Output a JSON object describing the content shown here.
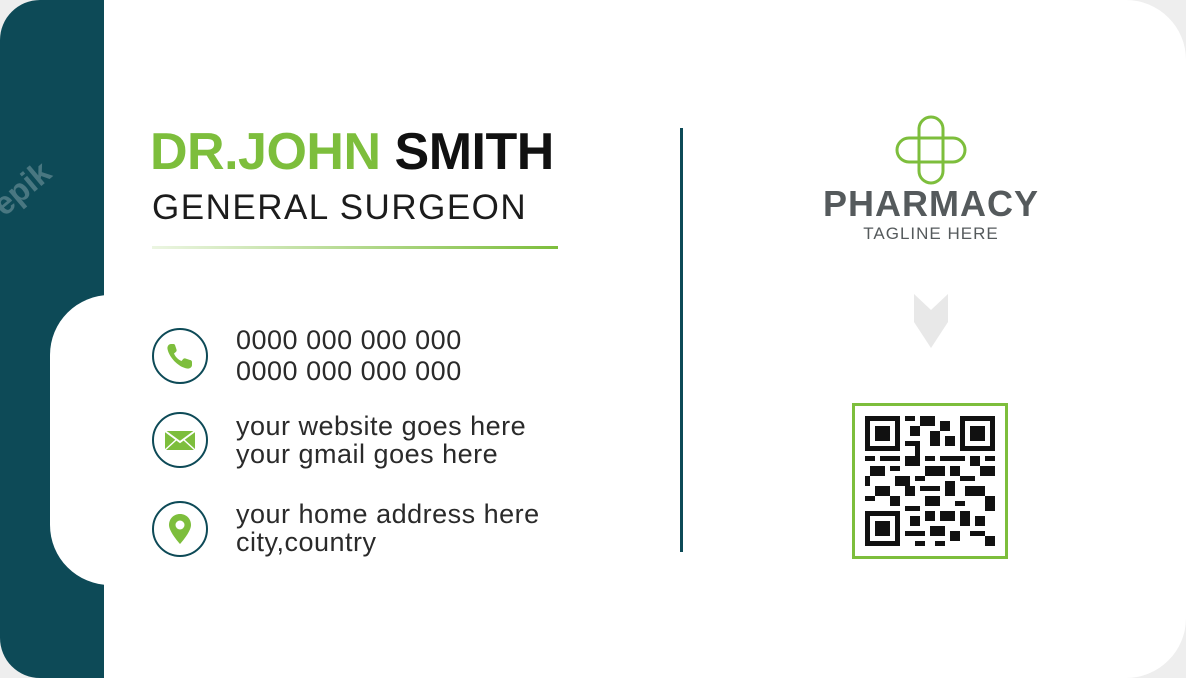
{
  "doctor": {
    "first_name": "DR.JOHN",
    "last_name": "SMITH",
    "title": "GENERAL SURGEON"
  },
  "contacts": {
    "phone_1": "0000 000 000 000",
    "phone_2": "0000 000 000 000",
    "website": "your website goes here",
    "email": "your gmail goes here",
    "address": "your home address here",
    "city": "city,country"
  },
  "brand": {
    "name": "PHARMACY",
    "tagline": "TAGLINE HERE",
    "logo_icon": "medical-cross-icon"
  },
  "icons": {
    "phone": "phone-icon",
    "mail": "envelope-icon",
    "location": "location-pin-icon",
    "qr": "qr-code"
  },
  "colors": {
    "teal": "#0d4a57",
    "green": "#7dbe3c",
    "gray": "#555a5c"
  },
  "watermark": "freepik"
}
